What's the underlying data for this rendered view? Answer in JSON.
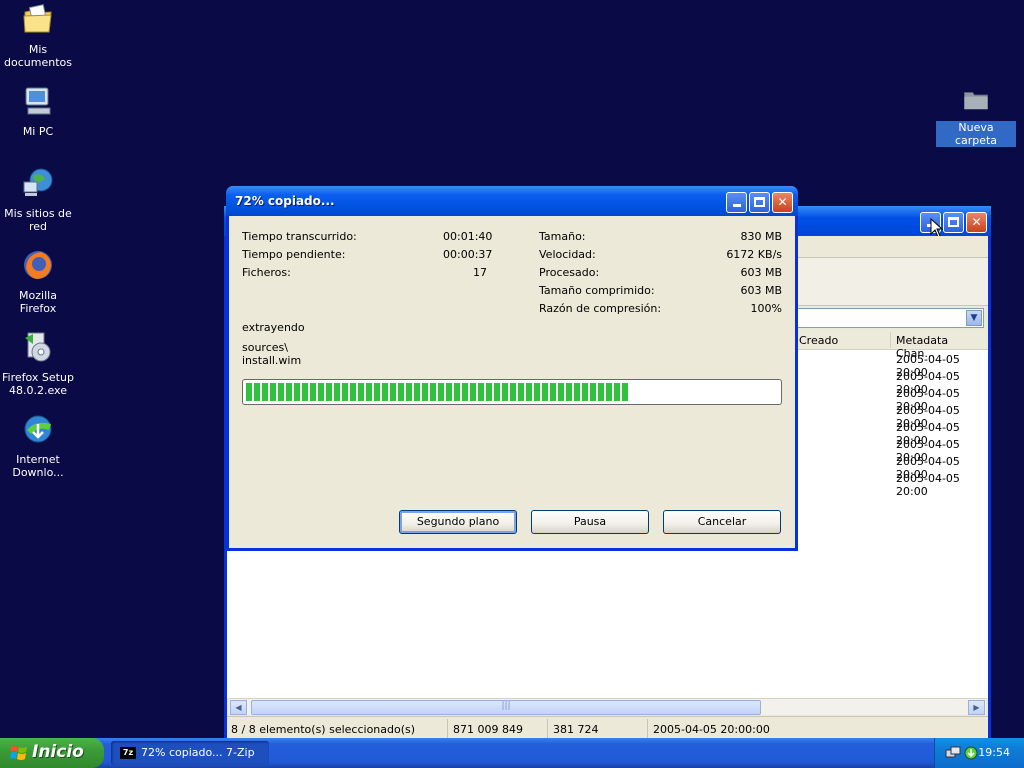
{
  "desktop": {
    "icons": [
      {
        "label": "Mis documentos",
        "icon": "my-documents-icon"
      },
      {
        "label": "Mi PC",
        "icon": "my-computer-icon"
      },
      {
        "label": "Mis sitios de red",
        "icon": "network-places-icon"
      },
      {
        "label": "Mozilla Firefox",
        "icon": "firefox-icon"
      },
      {
        "label": "Firefox Setup 48.0.2.exe",
        "icon": "installer-icon"
      },
      {
        "label": "Internet Downlo...",
        "icon": "internet-download-manager-icon"
      },
      {
        "label": "Nueva carpeta",
        "icon": "folder-icon"
      }
    ]
  },
  "background_window": {
    "columns": [
      "Creado",
      "Metadata Chan..."
    ],
    "rows": [
      "2005-04-05 20:00",
      "2005-04-05 20:00",
      "2005-04-05 20:00",
      "2005-04-05 20:00",
      "2005-04-05 20:00",
      "2005-04-05 20:00",
      "2005-04-05 20:00",
      "2005-04-05 20:00"
    ],
    "status": {
      "selection": "8 / 8 elemento(s) seleccionado(s)",
      "size": "871 009 849",
      "packed": "381 724",
      "date": "2005-04-05 20:00:00"
    }
  },
  "dialog": {
    "title": "72% copiado...",
    "elapsed_label": "Tiempo transcurrido:",
    "elapsed_value": "00:01:40",
    "remaining_label": "Tiempo pendiente:",
    "remaining_value": "00:00:37",
    "files_label": "Ficheros:",
    "files_value": "17",
    "size_label": "Tamaño:",
    "size_value": "830 MB",
    "speed_label": "Velocidad:",
    "speed_value": "6172 KB/s",
    "processed_label": "Procesado:",
    "processed_value": "603 MB",
    "compressed_label": "Tamaño comprimido:",
    "compressed_value": "603 MB",
    "ratio_label": "Razón de compresión:",
    "ratio_value": "100%",
    "operation": "extrayendo",
    "path_line1": "sources\\",
    "path_line2": "install.wim",
    "progress_percent": 72,
    "buttons": {
      "background": "Segundo plano",
      "pause": "Pausa",
      "cancel": "Cancelar"
    }
  },
  "taskbar": {
    "start_label": "Inicio",
    "task_label": "72% copiado... 7-Zip",
    "task_app_badge": "7z",
    "clock": "19:54"
  },
  "colors": {
    "desktop_bg": "#0a0a46",
    "titlebar_blue": "#0053e0",
    "progress_green": "#2fc23c",
    "start_green": "#3c9c38"
  }
}
